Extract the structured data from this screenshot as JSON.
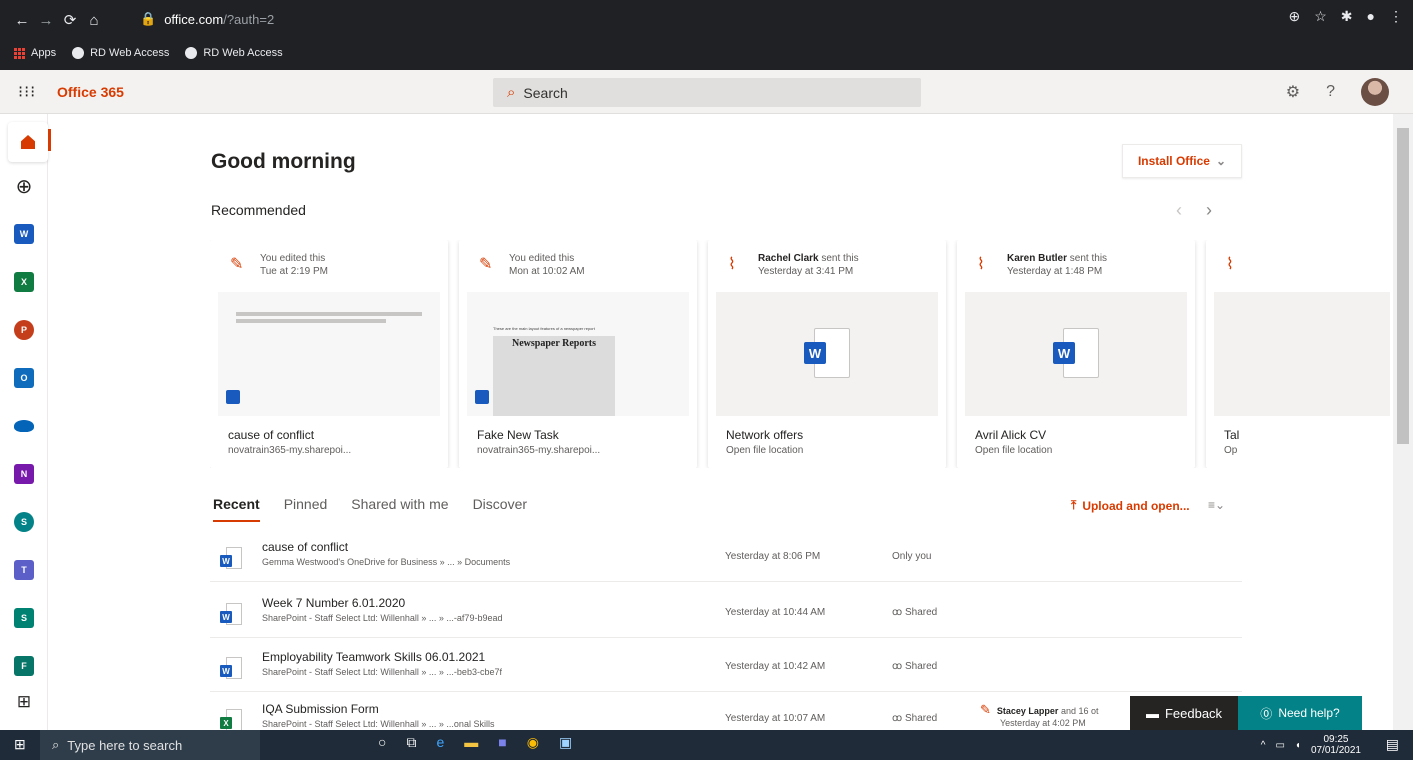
{
  "browser": {
    "url_host": "office.com",
    "url_path": "/?auth=2",
    "bookmarks": [
      {
        "label": "Apps"
      },
      {
        "label": "RD Web Access"
      },
      {
        "label": "RD Web Access"
      }
    ]
  },
  "header": {
    "brand": "Office 365",
    "search_placeholder": "Search",
    "help_label": "?"
  },
  "greeting": "Good morning",
  "install_label": "Install Office",
  "recommended": {
    "title": "Recommended",
    "cards": [
      {
        "actor": "",
        "action": "You edited this",
        "when": "Tue at 2:19 PM",
        "title": "cause of conflict",
        "location": "novatrain365-my.sharepoi..."
      },
      {
        "actor": "",
        "action": "You edited this",
        "when": "Mon at 10:02 AM",
        "title": "Fake New Task",
        "location": "novatrain365-my.sharepoi...",
        "thumb_caption": "These are the main layout features of a newspaper report",
        "thumb_heading": "Newspaper Reports"
      },
      {
        "actor": "Rachel Clark",
        "action": "sent this",
        "when": "Yesterday at 3:41 PM",
        "title": "Network offers",
        "location": "Open file location"
      },
      {
        "actor": "Karen Butler",
        "action": "sent this",
        "when": "Yesterday at 1:48 PM",
        "title": "Avril Alick CV",
        "location": "Open file location"
      },
      {
        "actor": "",
        "action": "",
        "when": "",
        "title": "Tal",
        "location": "Op"
      }
    ]
  },
  "tabs": [
    {
      "label": "Recent"
    },
    {
      "label": "Pinned"
    },
    {
      "label": "Shared with me"
    },
    {
      "label": "Discover"
    }
  ],
  "upload_label": "Upload and open...",
  "files": [
    {
      "app": "W",
      "name": "cause of conflict",
      "path": "Gemma Westwood's OneDrive for Business » ... » Documents",
      "date": "Yesterday at 8:06 PM",
      "share": "Only you",
      "activity_actor": "",
      "activity_rest": "",
      "activity_when": ""
    },
    {
      "app": "W",
      "name": "Week 7 Number 6.01.2020",
      "path": "SharePoint - Staff Select Ltd: Willenhall » ... » ...-af79-b9ead",
      "date": "Yesterday at 10:44 AM",
      "share": "Shared",
      "activity_actor": "",
      "activity_rest": "",
      "activity_when": ""
    },
    {
      "app": "W",
      "name": "Employability Teamwork Skills 06.01.2021",
      "path": "SharePoint - Staff Select Ltd: Willenhall » ... » ...-beb3-cbe7f",
      "date": "Yesterday at 10:42 AM",
      "share": "Shared",
      "activity_actor": "",
      "activity_rest": "",
      "activity_when": ""
    },
    {
      "app": "X",
      "name": "IQA Submission Form",
      "path": "SharePoint - Staff Select Ltd: Willenhall » ... » ...onal Skills",
      "date": "Yesterday at 10:07 AM",
      "share": "Shared",
      "activity_actor": "Stacey Lapper",
      "activity_rest": "and 16 ot",
      "activity_when": "Yesterday at 4:02 PM"
    }
  ],
  "feedback_label": "Feedback",
  "needhelp_label": "Need help?",
  "taskbar": {
    "search_placeholder": "Type here to search",
    "time": "09:25",
    "date": "07/01/2021"
  },
  "colors": {
    "accent": "#d83b01",
    "word": "#185abd",
    "excel": "#107c41",
    "teal": "#038387"
  }
}
